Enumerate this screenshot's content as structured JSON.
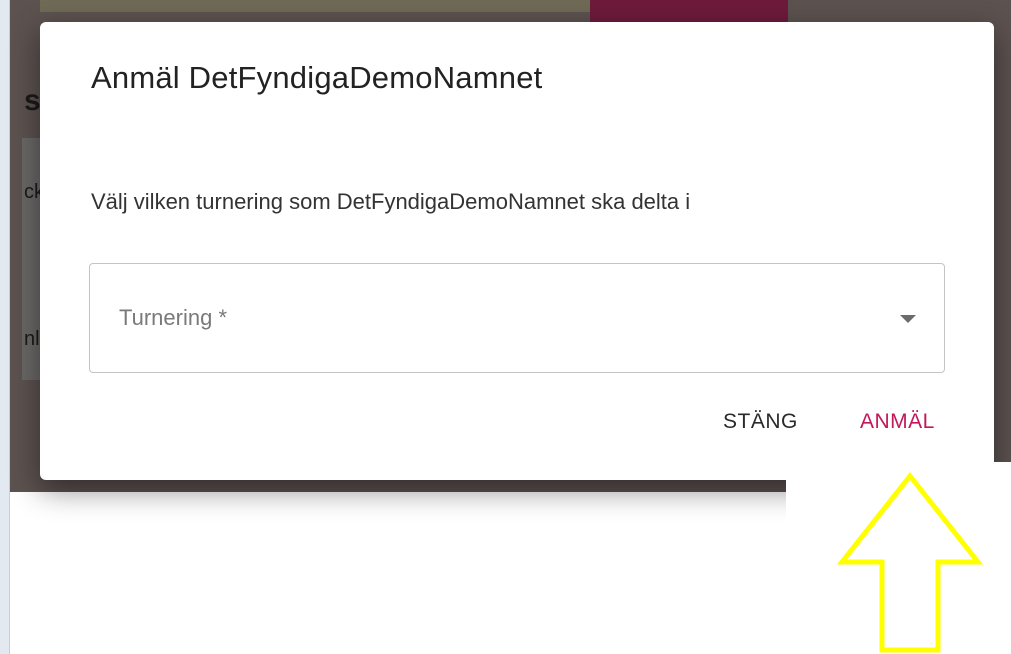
{
  "background": {
    "heading_fragment": "sk",
    "line1_fragment": "ckr",
    "line2_fragment": "nla"
  },
  "dialog": {
    "title": "Anmäl DetFyndigaDemoNamnet",
    "instruction": "Välj vilken turnering som DetFyndigaDemoNamnet ska delta i",
    "select": {
      "label": "Turnering *",
      "value": "",
      "icon": "chevron-down-icon"
    },
    "actions": {
      "close_label": "STÄNG",
      "submit_label": "ANMÄL"
    }
  },
  "annotation": {
    "icon": "arrow-up-icon",
    "color": "#ffff00"
  },
  "colors": {
    "accent": "#c2185b",
    "backdrop": "#5c5250"
  }
}
